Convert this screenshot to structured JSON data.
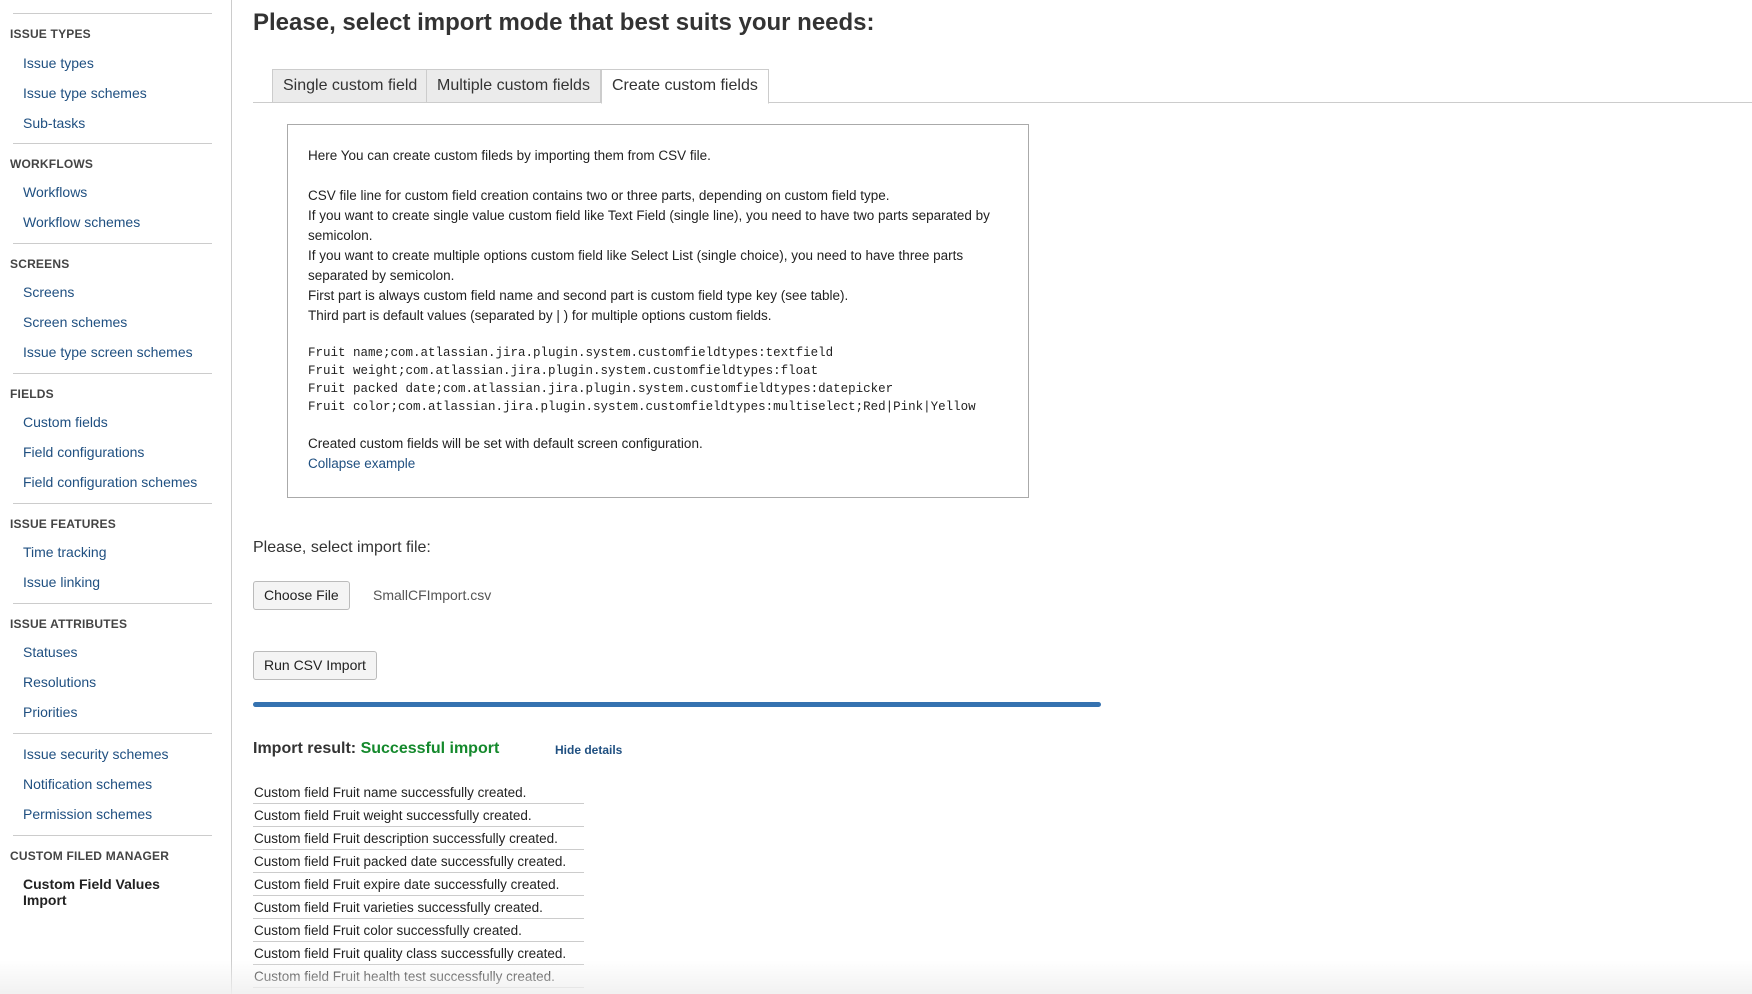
{
  "sidebar": {
    "sections": [
      {
        "heading": "ISSUE TYPES",
        "items": [
          "Issue types",
          "Issue type schemes",
          "Sub-tasks"
        ]
      },
      {
        "heading": "WORKFLOWS",
        "items": [
          "Workflows",
          "Workflow schemes"
        ]
      },
      {
        "heading": "SCREENS",
        "items": [
          "Screens",
          "Screen schemes",
          "Issue type screen schemes"
        ]
      },
      {
        "heading": "FIELDS",
        "items": [
          "Custom fields",
          "Field configurations",
          "Field configuration schemes"
        ]
      },
      {
        "heading": "ISSUE FEATURES",
        "items": [
          "Time tracking",
          "Issue linking"
        ]
      },
      {
        "heading": "ISSUE ATTRIBUTES",
        "items": [
          "Statuses",
          "Resolutions",
          "Priorities"
        ]
      },
      {
        "heading": "",
        "items": [
          "Issue security schemes",
          "Notification schemes",
          "Permission schemes"
        ]
      },
      {
        "heading": "CUSTOM FILED MANAGER",
        "items": [
          "Custom Field Values Import"
        ]
      }
    ]
  },
  "main": {
    "title": "Please, select import mode that best suits your needs:",
    "tabs": [
      {
        "label": "Single custom field"
      },
      {
        "label": "Multiple custom fields"
      },
      {
        "label": "Create custom fields"
      }
    ],
    "active_tab": "Create custom fields",
    "info": {
      "intro": "Here You can create custom fileds by importing them from CSV file.",
      "lines": [
        "CSV file line for custom field creation contains two or three parts, depending on custom field type.",
        "If you want to create single value custom field like Text Field (single line), you need to have two parts separated by semicolon.",
        "If you want to create multiple options custom field like Select List (single choice), you need to have three parts separated by semicolon.",
        "First part is always custom field name and second part is custom field type key (see table).",
        "Third part is default values (separated by | ) for multiple options custom fields."
      ],
      "code": [
        "Fruit name;com.atlassian.jira.plugin.system.customfieldtypes:textfield",
        "Fruit weight;com.atlassian.jira.plugin.system.customfieldtypes:float",
        "Fruit packed date;com.atlassian.jira.plugin.system.customfieldtypes:datepicker",
        "Fruit color;com.atlassian.jira.plugin.system.customfieldtypes:multiselect;Red|Pink|Yellow"
      ],
      "footer": "Created custom fields will be set with default screen configuration.",
      "collapse_label": "Collapse example"
    },
    "select_file_label": "Please, select import file:",
    "choose_file_label": "Choose File",
    "file_name": "SmallCFImport.csv",
    "run_button_label": "Run CSV Import",
    "progress_percent": 100,
    "result": {
      "label": "Import result:",
      "status": "Successful import",
      "hide_details_label": "Hide details",
      "messages": [
        "Custom field Fruit name successfully created.",
        "Custom field Fruit weight successfully created.",
        "Custom field Fruit description successfully created.",
        "Custom field Fruit packed date successfully created.",
        "Custom field Fruit expire date successfully created.",
        "Custom field Fruit varieties successfully created.",
        "Custom field Fruit color successfully created.",
        "Custom field Fruit quality class successfully created.",
        "Custom field Fruit health test successfully created."
      ]
    }
  },
  "colors": {
    "link": "#205081",
    "success": "#14892c",
    "progress": "#3572b0",
    "border": "#cccccc"
  }
}
